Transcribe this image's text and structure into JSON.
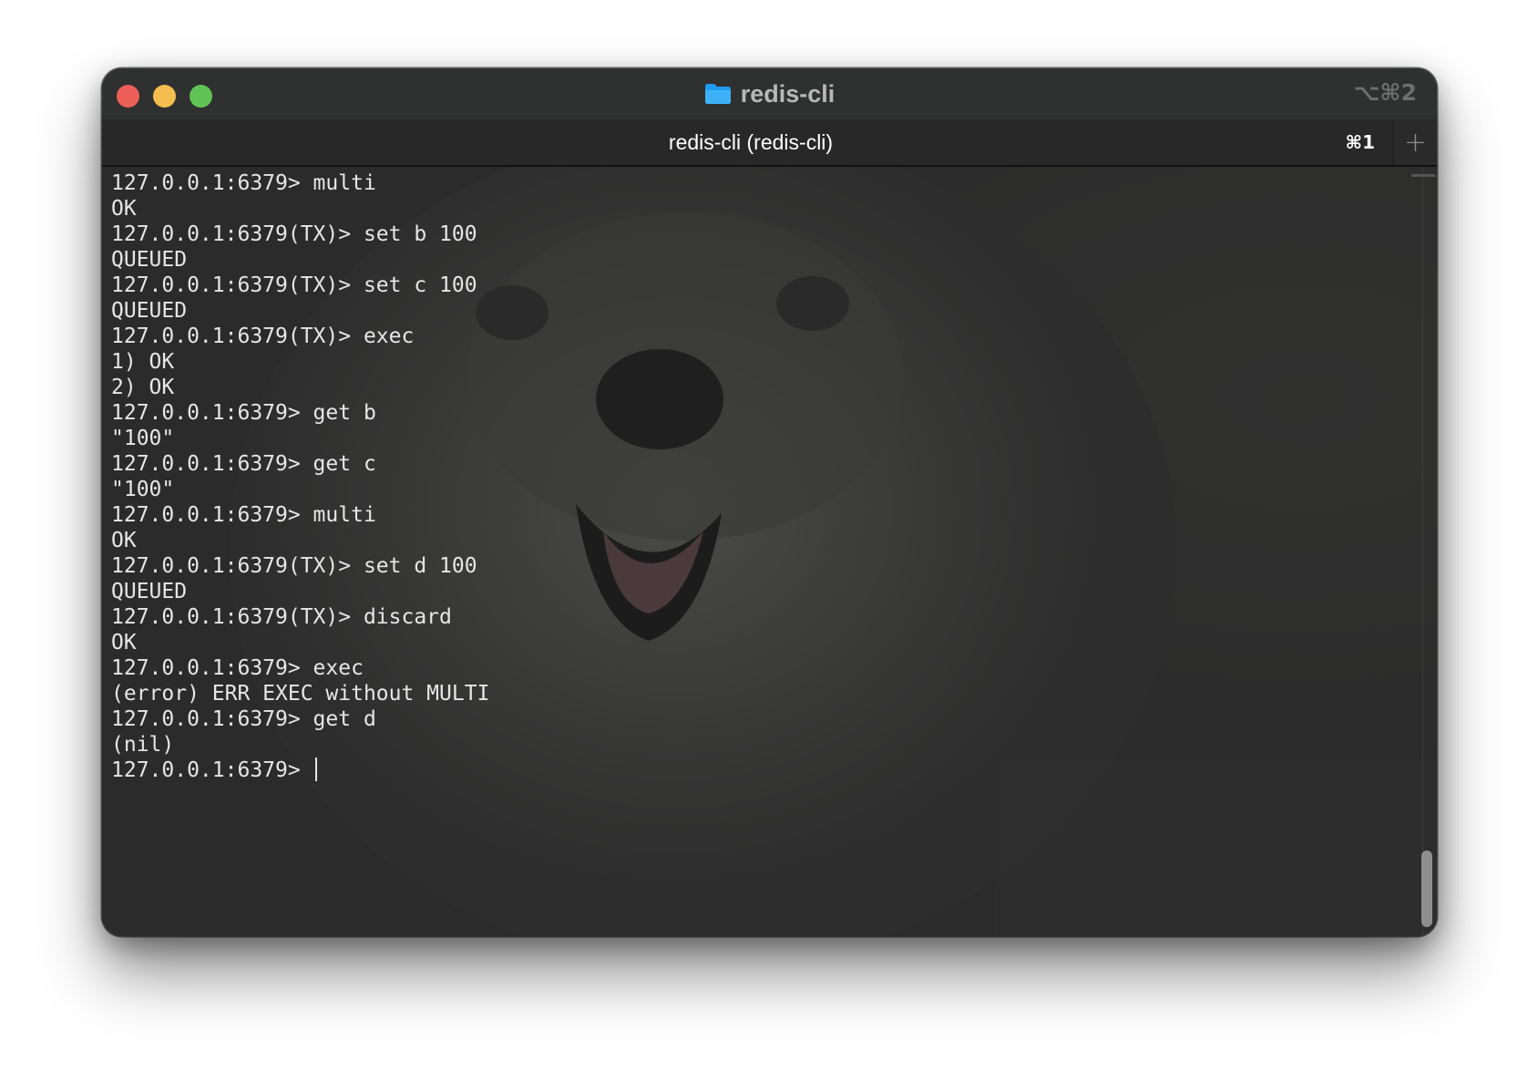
{
  "window": {
    "title": "redis-cli",
    "title_icon": "folder-icon",
    "window_shortcut": "⌥⌘2",
    "traffic_lights": {
      "close_color": "#ec5f57",
      "minimize_color": "#f3bd4f",
      "maximize_color": "#60c454"
    }
  },
  "tab": {
    "title": "redis-cli (redis-cli)",
    "shortcut": "⌘1",
    "new_tab_icon": "plus-icon"
  },
  "terminal": {
    "lines": [
      "127.0.0.1:6379> multi",
      "OK",
      "127.0.0.1:6379(TX)> set b 100",
      "QUEUED",
      "127.0.0.1:6379(TX)> set c 100",
      "QUEUED",
      "127.0.0.1:6379(TX)> exec",
      "1) OK",
      "2) OK",
      "127.0.0.1:6379> get b",
      "\"100\"",
      "127.0.0.1:6379> get c",
      "\"100\"",
      "127.0.0.1:6379> multi",
      "OK",
      "127.0.0.1:6379(TX)> set d 100",
      "QUEUED",
      "127.0.0.1:6379(TX)> discard",
      "OK",
      "127.0.0.1:6379> exec",
      "(error) ERR EXEC without MULTI",
      "127.0.0.1:6379> get d",
      "(nil)"
    ],
    "prompt": "127.0.0.1:6379> ",
    "text_color": "#e6e6e6",
    "background_color": "#2d2d2d"
  }
}
